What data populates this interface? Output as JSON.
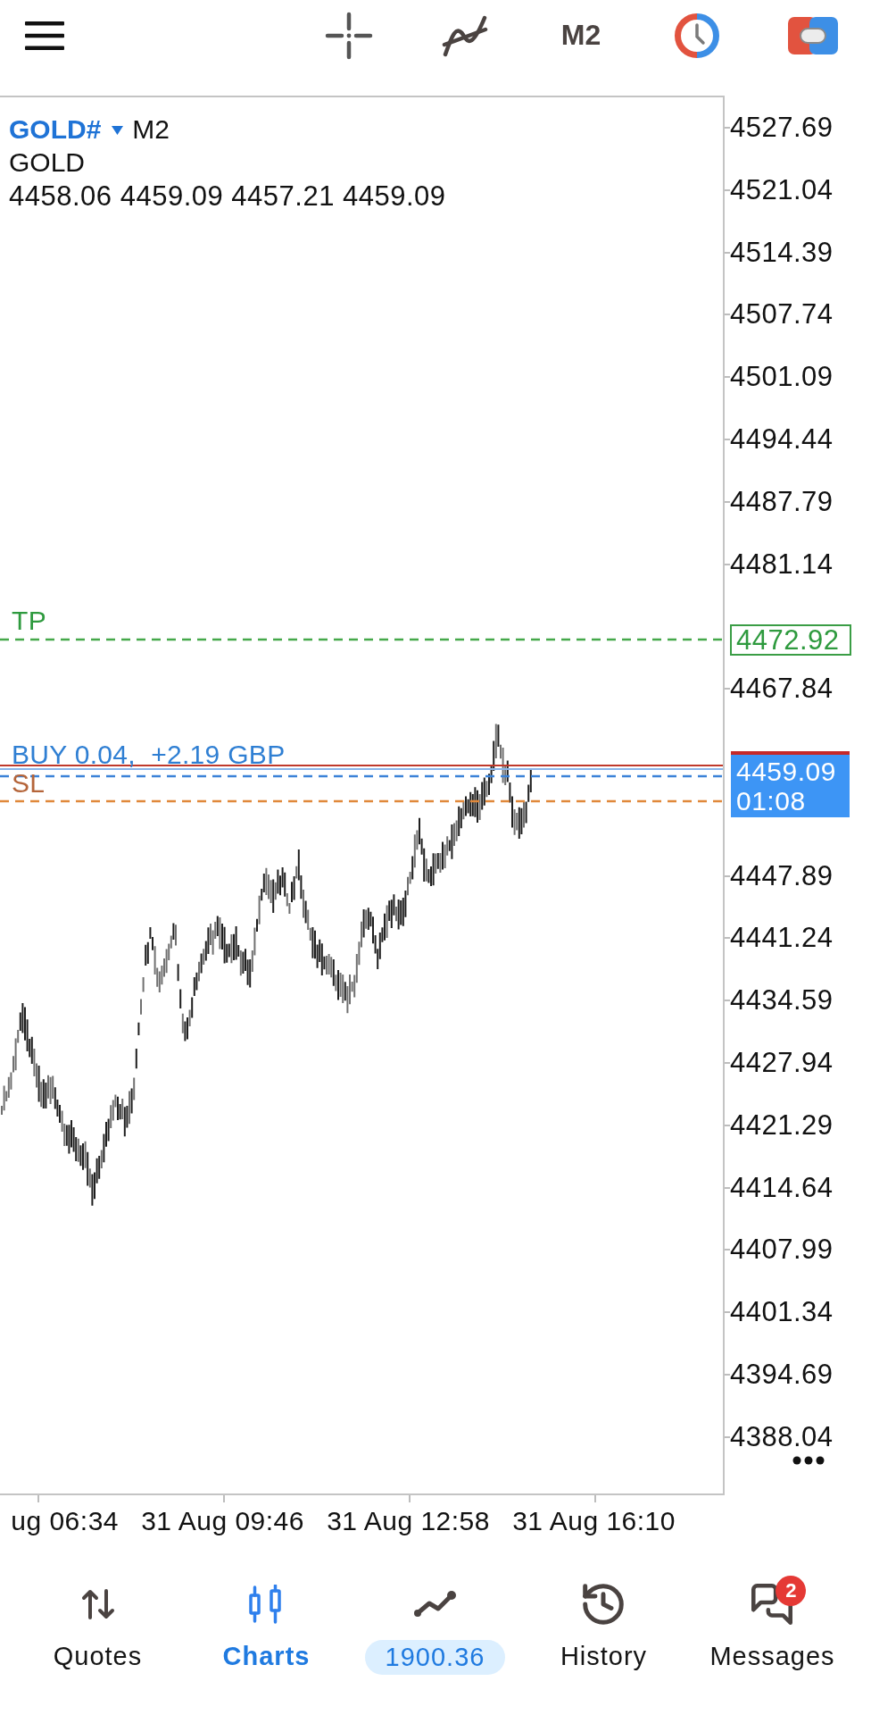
{
  "toolbar": {
    "timeframe": "M2"
  },
  "chart": {
    "symbol": "GOLD#",
    "timeframe": "M2",
    "description": "GOLD",
    "ohlc": "4458.06 4459.09 4457.21 4459.09",
    "levels": [
      {
        "kind": "tp",
        "label": "TP",
        "price_tag": "4472.92"
      },
      {
        "kind": "position",
        "label": "BUY 0.04,  +2.19 GBP"
      },
      {
        "kind": "sl",
        "label": "SL"
      }
    ],
    "current_price": {
      "price": "4459.09",
      "countdown": "01:08"
    },
    "price_axis": [
      "4527.69",
      "4521.04",
      "4514.39",
      "4507.74",
      "4501.09",
      "4494.44",
      "4487.79",
      "4481.14",
      "4467.84",
      "4447.89",
      "4441.24",
      "4434.59",
      "4427.94",
      "4421.29",
      "4414.64",
      "4407.99",
      "4401.34",
      "4394.69",
      "4388.04"
    ],
    "time_axis": [
      "ug 06:34",
      "31 Aug 09:46",
      "31 Aug 12:58",
      "31 Aug 16:10"
    ]
  },
  "nav": [
    {
      "kind": "tab",
      "label": "Quotes",
      "selected": false
    },
    {
      "kind": "tab",
      "label": "Charts",
      "selected": true
    },
    {
      "kind": "balance",
      "label": "1900.36",
      "selected": false
    },
    {
      "kind": "tab",
      "label": "History",
      "selected": false
    },
    {
      "kind": "tab",
      "label": "Messages",
      "selected": false,
      "badge": "2"
    }
  ]
}
